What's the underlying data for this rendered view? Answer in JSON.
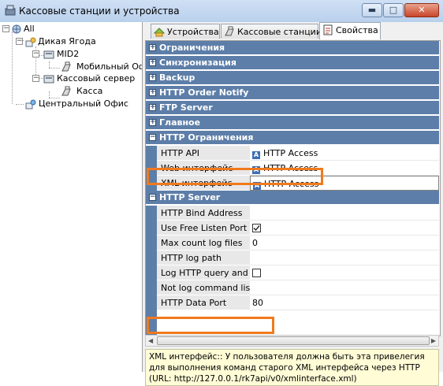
{
  "window": {
    "title": "Кассовые станции и устройства",
    "buttons": {
      "minimize": "▬",
      "maximize": "□",
      "close": "✕"
    }
  },
  "tree": {
    "root": "All",
    "items": [
      {
        "label": "Дикая Ягода",
        "icon": "organization-icon"
      },
      {
        "label": "MID2",
        "icon": "server-icon"
      },
      {
        "label": "Мобильный Оф",
        "icon": "pos-terminal-icon"
      },
      {
        "label": "Кассовый сервер",
        "icon": "server-icon"
      },
      {
        "label": "Касса",
        "icon": "pos-terminal-icon"
      },
      {
        "label": "Центральный Офис",
        "icon": "organization-icon"
      }
    ]
  },
  "tabs": [
    {
      "label": "Устройства",
      "icon": "devices-icon"
    },
    {
      "label": "Кассовые станции",
      "icon": "cash-stations-icon"
    },
    {
      "label": "Свойства",
      "icon": "properties-icon",
      "active": true
    }
  ],
  "categories": {
    "restrictions": "Ограничения",
    "sync": "Синхронизация",
    "backup": "Backup",
    "order_notify": "HTTP Order Notify",
    "ftp": "FTP Server",
    "main": "Главное",
    "http_restrictions": "HTTP Ограничения",
    "http_server": "HTTP Server"
  },
  "expander": {
    "plus": "+",
    "minus": "−"
  },
  "http_restrictions": {
    "http_api": {
      "name": "HTTP API",
      "value": "HTTP Access"
    },
    "web": {
      "name": "Web интерфейс",
      "value": "HTTP Access"
    },
    "xml": {
      "name": "XML интерфейс",
      "value": "HTTP Access"
    }
  },
  "access_icon": "A",
  "http_server": {
    "bind_address": {
      "name": "HTTP Bind Address",
      "value": ""
    },
    "free_port": {
      "name": "Use Free Listen Port",
      "checked": true
    },
    "max_log": {
      "name": "Max count log files",
      "value": "0"
    },
    "log_path": {
      "name": "HTTP log path",
      "value": ""
    },
    "log_query": {
      "name": "Log HTTP query and re",
      "checked": false
    },
    "not_log": {
      "name": "Not log command list",
      "value": ""
    },
    "data_port": {
      "name": "HTTP Data Port",
      "value": "80"
    }
  },
  "scroll": {
    "left": "◀",
    "right": "▶"
  },
  "description": "XML интерфейс:: У пользователя должна быть эта привелегия для выполнения команд старого XML интерфейса через HTTP (URL: http://127.0.0.1/rk7api/v0/xmlinterface.xml)",
  "colors": {
    "category": "#5d7ea8",
    "highlight": "#f07a1c",
    "description_bg": "#fffcd6"
  }
}
